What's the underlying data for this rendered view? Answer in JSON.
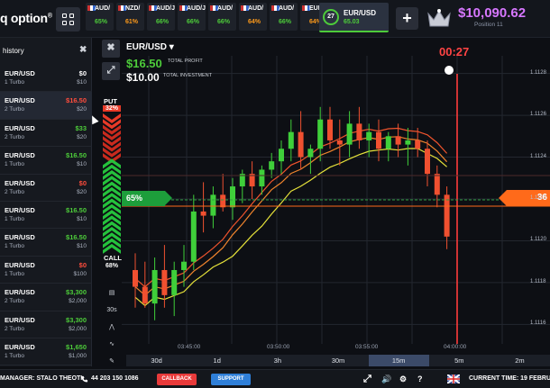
{
  "header": {
    "logo": "q option",
    "logo_sup": "®",
    "asset_tabs": [
      {
        "name": "AUD/",
        "payout": "65%",
        "color": "#4dcc3a"
      },
      {
        "name": "NZD/",
        "payout": "61%",
        "color": "#ff9b1a"
      },
      {
        "name": "AUD/J",
        "payout": "66%",
        "color": "#4dcc3a"
      },
      {
        "name": "AUD/J",
        "payout": "66%",
        "color": "#4dcc3a"
      },
      {
        "name": "AUD/",
        "payout": "66%",
        "color": "#4dcc3a"
      },
      {
        "name": "AUD/",
        "payout": "64%",
        "color": "#ff9b1a"
      },
      {
        "name": "AUD/",
        "payout": "66%",
        "color": "#4dcc3a"
      },
      {
        "name": "EUR/",
        "payout": "64%",
        "color": "#ff9b1a"
      }
    ],
    "active_tab": {
      "name": "EUR/USD",
      "payout": "65.03",
      "timer": "27"
    },
    "plus": "+",
    "balance": "$10,090.62",
    "position": "Position 11"
  },
  "sidebar": {
    "title": "history",
    "close": "✖",
    "trades": [
      {
        "pair": "EUR/USD",
        "type": "1 Turbo",
        "result": "$0",
        "invest": "$10",
        "color": "#ffffff"
      },
      {
        "pair": "EUR/USD",
        "type": "2 Turbo",
        "result": "$16.50",
        "invest": "$20",
        "color": "#ff4d3d"
      },
      {
        "pair": "EUR/USD",
        "type": "2 Turbo",
        "result": "$33",
        "invest": "$20",
        "color": "#4dcc3a"
      },
      {
        "pair": "EUR/USD",
        "type": "1 Turbo",
        "result": "$16.50",
        "invest": "$10",
        "color": "#4dcc3a"
      },
      {
        "pair": "EUR/USD",
        "type": "2 Turbo",
        "result": "$0",
        "invest": "$20",
        "color": "#ff4d3d"
      },
      {
        "pair": "EUR/USD",
        "type": "1 Turbo",
        "result": "$16.50",
        "invest": "$10",
        "color": "#4dcc3a"
      },
      {
        "pair": "EUR/USD",
        "type": "1 Turbo",
        "result": "$16.50",
        "invest": "$10",
        "color": "#4dcc3a"
      },
      {
        "pair": "EUR/USD",
        "type": "1 Turbo",
        "result": "$0",
        "invest": "$100",
        "color": "#ff4d3d"
      },
      {
        "pair": "EUR/USD",
        "type": "2 Turbo",
        "result": "$3,300",
        "invest": "$2,000",
        "color": "#4dcc3a"
      },
      {
        "pair": "EUR/USD",
        "type": "2 Turbo",
        "result": "$3,300",
        "invest": "$2,000",
        "color": "#4dcc3a"
      },
      {
        "pair": "EUR/USD",
        "type": "1 Turbo",
        "result": "$1,650",
        "invest": "$1,000",
        "color": "#4dcc3a"
      }
    ]
  },
  "tools": {
    "close": "✖",
    "expand": "⤢"
  },
  "side_tools": [
    "▤",
    "30s",
    "⋀",
    "∿",
    "✎"
  ],
  "trade_panel": {
    "put_label": "PUT",
    "put_pct": "32%",
    "call_label": "CALL",
    "call_pct": "68%",
    "call_marker_pct": "65%"
  },
  "chart_header": {
    "pair": "EUR/USD ▾",
    "profit": "$16.50",
    "profit_label": "TOTAL PROFIT",
    "investment": "$10.00",
    "investment_label": "TOTAL INVESTMENT",
    "timer": "00:27",
    "price_tag": "36"
  },
  "chart_data": {
    "type": "candlestick",
    "y_ticks": [
      "1.1128",
      "1.1126",
      "1.1124",
      "1.1122",
      "1.1120",
      "1.1118",
      "1.1116"
    ],
    "x_ticks": [
      "03:45:00",
      "03:50:00",
      "03:55:00",
      "04:00:00"
    ],
    "ylim": [
      1.11155,
      1.11285
    ],
    "candles": [
      {
        "o": 1.11186,
        "h": 1.11194,
        "l": 1.11168,
        "c": 1.11178
      },
      {
        "o": 1.11178,
        "h": 1.1119,
        "l": 1.11168,
        "c": 1.1117
      },
      {
        "o": 1.1117,
        "h": 1.11192,
        "l": 1.11162,
        "c": 1.11186
      },
      {
        "o": 1.11186,
        "h": 1.11198,
        "l": 1.11168,
        "c": 1.11174
      },
      {
        "o": 1.11174,
        "h": 1.1119,
        "l": 1.11164,
        "c": 1.11186
      },
      {
        "o": 1.11186,
        "h": 1.11198,
        "l": 1.11178,
        "c": 1.1119
      },
      {
        "o": 1.1119,
        "h": 1.11222,
        "l": 1.11186,
        "c": 1.11214
      },
      {
        "o": 1.11214,
        "h": 1.11228,
        "l": 1.11204,
        "c": 1.11212
      },
      {
        "o": 1.11212,
        "h": 1.11226,
        "l": 1.11206,
        "c": 1.11222
      },
      {
        "o": 1.11222,
        "h": 1.11232,
        "l": 1.11214,
        "c": 1.11216
      },
      {
        "o": 1.11216,
        "h": 1.1123,
        "l": 1.1121,
        "c": 1.11226
      },
      {
        "o": 1.11226,
        "h": 1.11234,
        "l": 1.11218,
        "c": 1.11232
      },
      {
        "o": 1.11232,
        "h": 1.11238,
        "l": 1.1122,
        "c": 1.11226
      },
      {
        "o": 1.11226,
        "h": 1.11236,
        "l": 1.11222,
        "c": 1.11234
      },
      {
        "o": 1.11234,
        "h": 1.11242,
        "l": 1.1123,
        "c": 1.11238
      },
      {
        "o": 1.11238,
        "h": 1.11248,
        "l": 1.11232,
        "c": 1.11244
      },
      {
        "o": 1.11244,
        "h": 1.11258,
        "l": 1.11238,
        "c": 1.11252
      },
      {
        "o": 1.11252,
        "h": 1.11262,
        "l": 1.11234,
        "c": 1.1124
      },
      {
        "o": 1.1124,
        "h": 1.11246,
        "l": 1.11232,
        "c": 1.11244
      },
      {
        "o": 1.11244,
        "h": 1.11264,
        "l": 1.11238,
        "c": 1.11258
      },
      {
        "o": 1.11258,
        "h": 1.11264,
        "l": 1.11244,
        "c": 1.11248
      },
      {
        "o": 1.11248,
        "h": 1.11258,
        "l": 1.11236,
        "c": 1.11246
      },
      {
        "o": 1.11246,
        "h": 1.11262,
        "l": 1.1124,
        "c": 1.11256
      },
      {
        "o": 1.11256,
        "h": 1.11264,
        "l": 1.11244,
        "c": 1.11248
      },
      {
        "o": 1.11248,
        "h": 1.11256,
        "l": 1.1124,
        "c": 1.11252
      },
      {
        "o": 1.11252,
        "h": 1.11258,
        "l": 1.11238,
        "c": 1.11244
      },
      {
        "o": 1.11244,
        "h": 1.11252,
        "l": 1.11238,
        "c": 1.1125
      },
      {
        "o": 1.1125,
        "h": 1.11256,
        "l": 1.1124,
        "c": 1.11246
      },
      {
        "o": 1.11246,
        "h": 1.11254,
        "l": 1.11236,
        "c": 1.11248
      },
      {
        "o": 1.11248,
        "h": 1.11254,
        "l": 1.1124,
        "c": 1.11244
      },
      {
        "o": 1.11244,
        "h": 1.11248,
        "l": 1.11226,
        "c": 1.11232
      },
      {
        "o": 1.11232,
        "h": 1.11236,
        "l": 1.11216,
        "c": 1.11222
      },
      {
        "o": 1.11222,
        "h": 1.11226,
        "l": 1.11196,
        "c": 1.11202
      }
    ]
  },
  "timeframes": [
    "30d",
    "1d",
    "3h",
    "30m",
    "15m",
    "5m",
    "2m"
  ],
  "selected_timeframe": "15m",
  "bottom": {
    "manager": "MANAGER: STALO THEOTI",
    "phone": "44 203 150 1086",
    "callback": "CALLBACK",
    "support": "SUPPORT",
    "current_time": "CURRENT TIME: 19 FEBRUA"
  }
}
